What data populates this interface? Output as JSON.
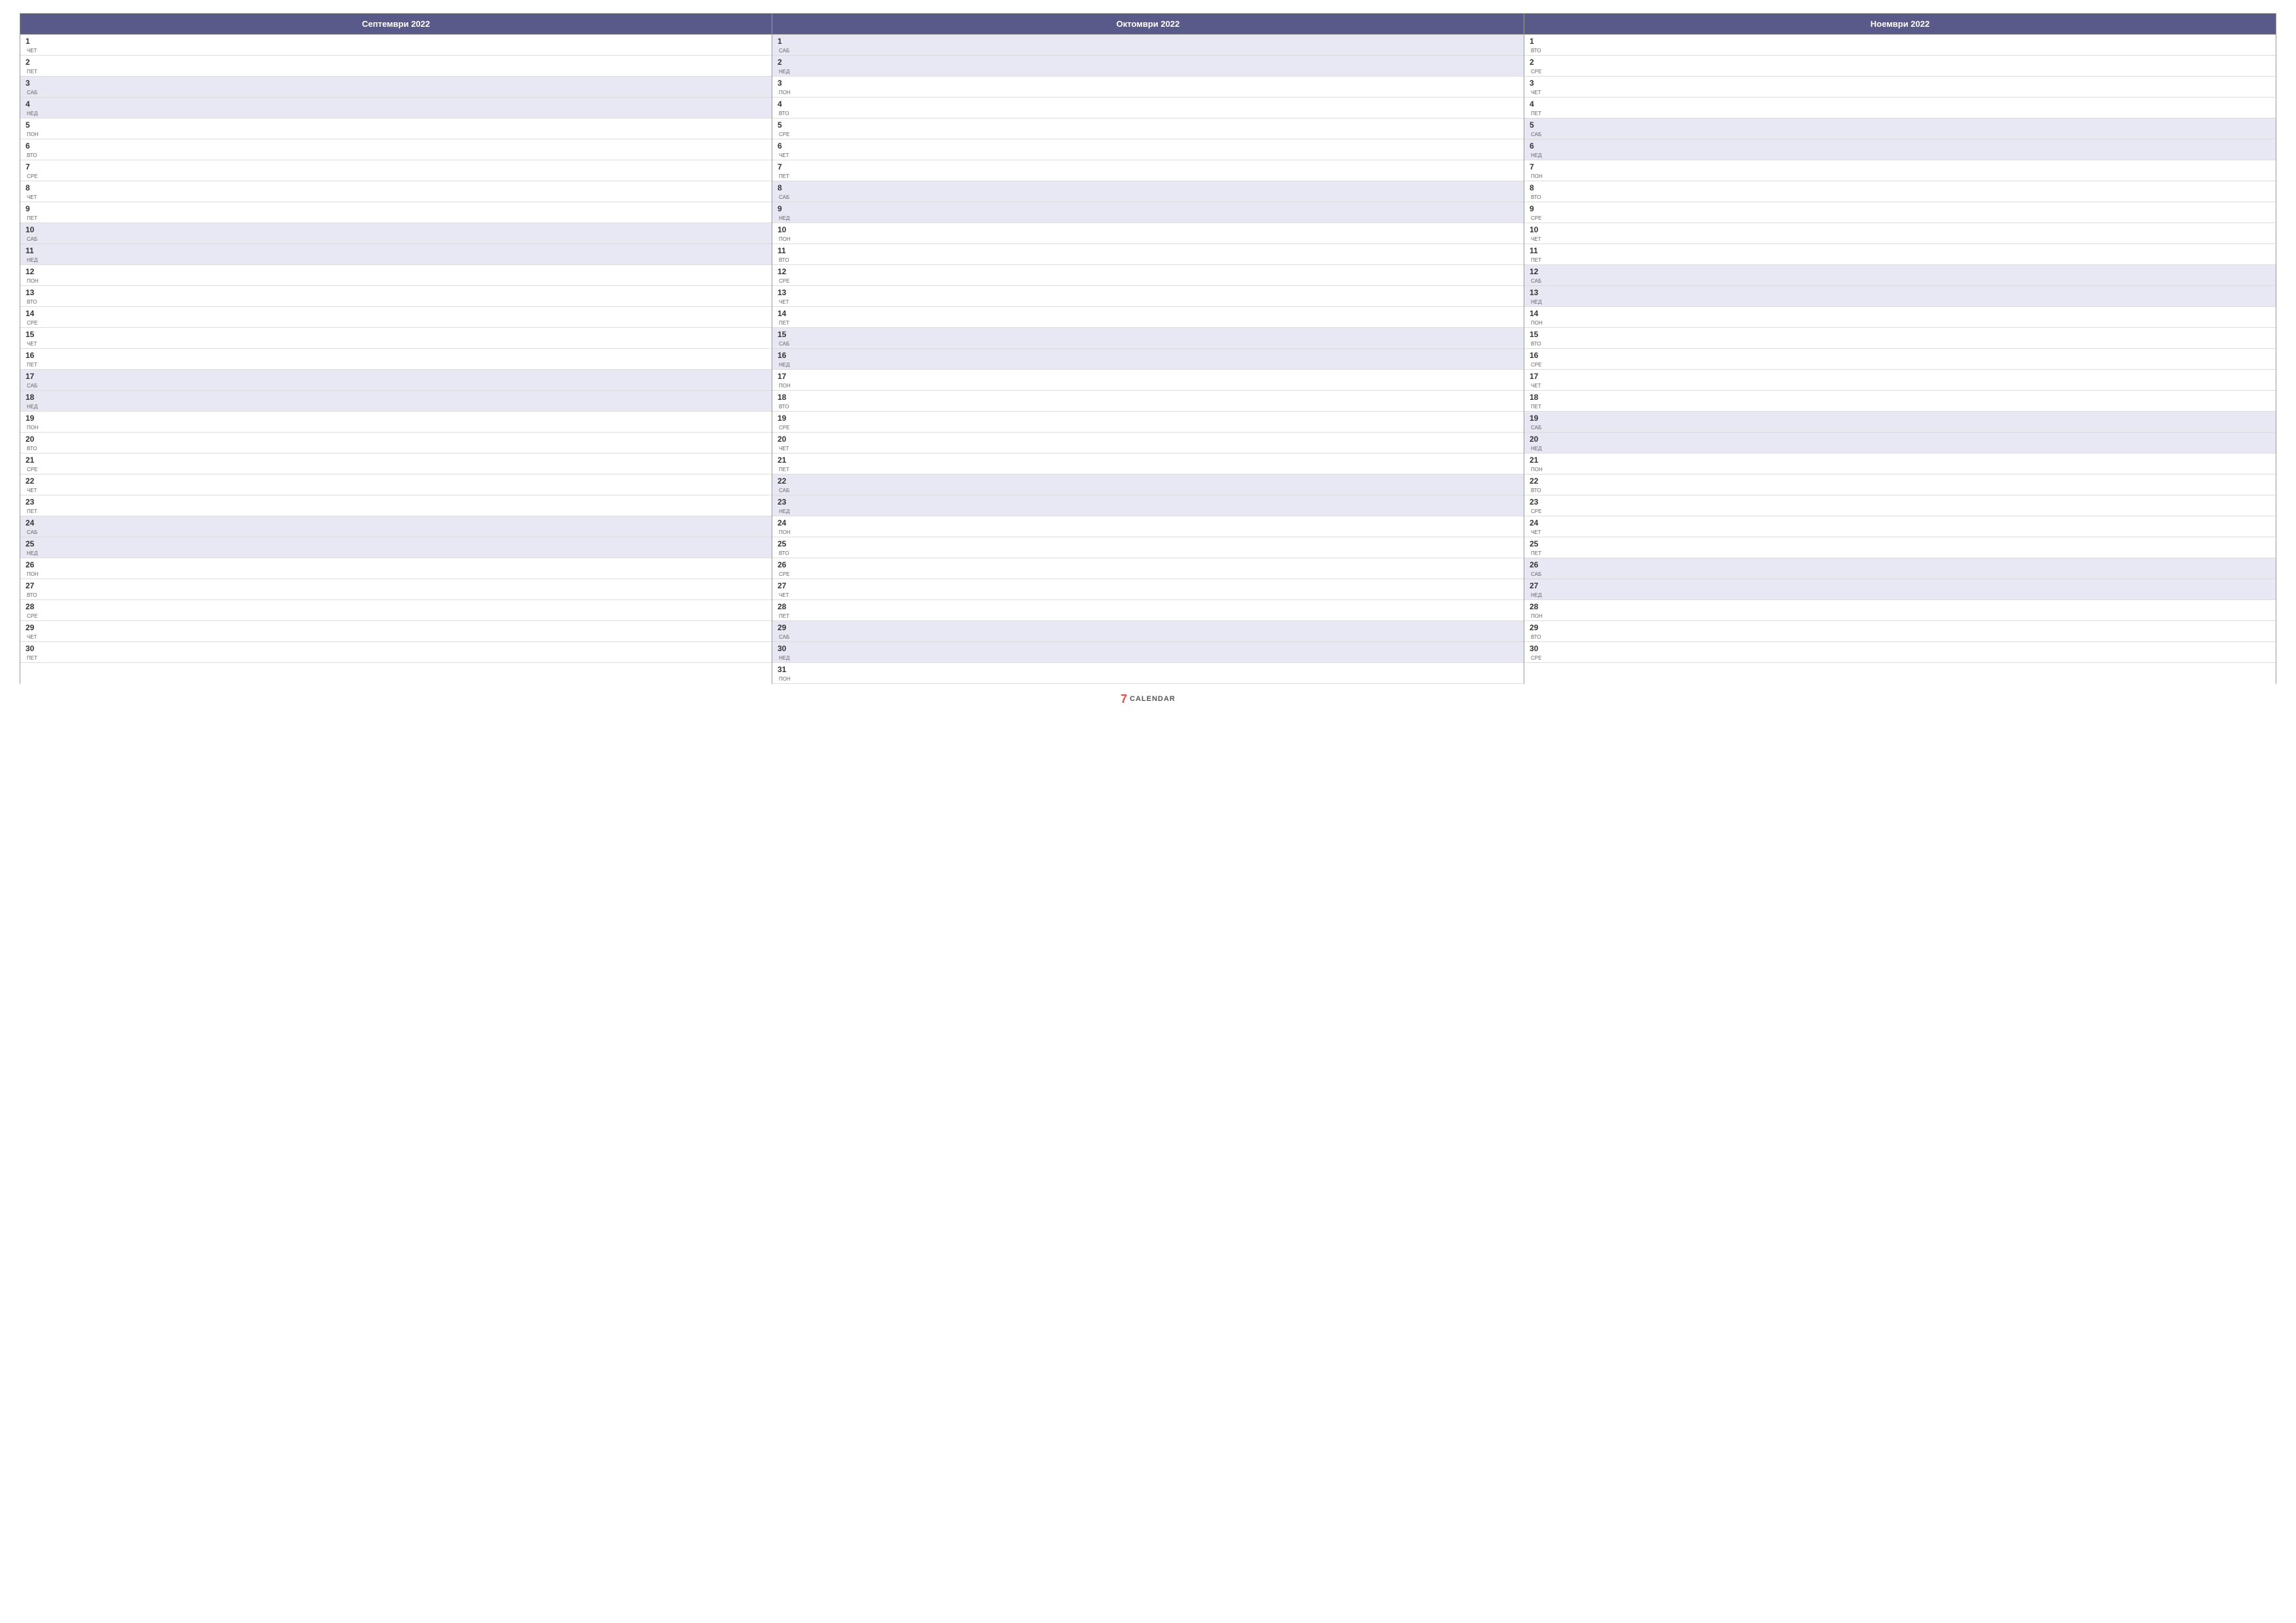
{
  "calendar": {
    "months": [
      {
        "id": "september",
        "header": "Септември 2022",
        "days": [
          {
            "num": "1",
            "name": "ЧЕТ",
            "weekend": false
          },
          {
            "num": "2",
            "name": "ПЕТ",
            "weekend": false
          },
          {
            "num": "3",
            "name": "САБ",
            "weekend": true
          },
          {
            "num": "4",
            "name": "НЕД",
            "weekend": true
          },
          {
            "num": "5",
            "name": "ПОН",
            "weekend": false
          },
          {
            "num": "6",
            "name": "ВТО",
            "weekend": false
          },
          {
            "num": "7",
            "name": "СРЕ",
            "weekend": false
          },
          {
            "num": "8",
            "name": "ЧЕТ",
            "weekend": false
          },
          {
            "num": "9",
            "name": "ПЕТ",
            "weekend": false
          },
          {
            "num": "10",
            "name": "САБ",
            "weekend": true
          },
          {
            "num": "11",
            "name": "НЕД",
            "weekend": true
          },
          {
            "num": "12",
            "name": "ПОН",
            "weekend": false
          },
          {
            "num": "13",
            "name": "ВТО",
            "weekend": false
          },
          {
            "num": "14",
            "name": "СРЕ",
            "weekend": false
          },
          {
            "num": "15",
            "name": "ЧЕТ",
            "weekend": false
          },
          {
            "num": "16",
            "name": "ПЕТ",
            "weekend": false
          },
          {
            "num": "17",
            "name": "САБ",
            "weekend": true
          },
          {
            "num": "18",
            "name": "НЕД",
            "weekend": true
          },
          {
            "num": "19",
            "name": "ПОН",
            "weekend": false
          },
          {
            "num": "20",
            "name": "ВТО",
            "weekend": false
          },
          {
            "num": "21",
            "name": "СРЕ",
            "weekend": false
          },
          {
            "num": "22",
            "name": "ЧЕТ",
            "weekend": false
          },
          {
            "num": "23",
            "name": "ПЕТ",
            "weekend": false
          },
          {
            "num": "24",
            "name": "САБ",
            "weekend": true
          },
          {
            "num": "25",
            "name": "НЕД",
            "weekend": true
          },
          {
            "num": "26",
            "name": "ПОН",
            "weekend": false
          },
          {
            "num": "27",
            "name": "ВТО",
            "weekend": false
          },
          {
            "num": "28",
            "name": "СРЕ",
            "weekend": false
          },
          {
            "num": "29",
            "name": "ЧЕТ",
            "weekend": false
          },
          {
            "num": "30",
            "name": "ПЕТ",
            "weekend": false
          }
        ]
      },
      {
        "id": "october",
        "header": "Октомври 2022",
        "days": [
          {
            "num": "1",
            "name": "САБ",
            "weekend": true
          },
          {
            "num": "2",
            "name": "НЕД",
            "weekend": true
          },
          {
            "num": "3",
            "name": "ПОН",
            "weekend": false
          },
          {
            "num": "4",
            "name": "ВТО",
            "weekend": false
          },
          {
            "num": "5",
            "name": "СРЕ",
            "weekend": false
          },
          {
            "num": "6",
            "name": "ЧЕТ",
            "weekend": false
          },
          {
            "num": "7",
            "name": "ПЕТ",
            "weekend": false
          },
          {
            "num": "8",
            "name": "САБ",
            "weekend": true
          },
          {
            "num": "9",
            "name": "НЕД",
            "weekend": true
          },
          {
            "num": "10",
            "name": "ПОН",
            "weekend": false
          },
          {
            "num": "11",
            "name": "ВТО",
            "weekend": false
          },
          {
            "num": "12",
            "name": "СРЕ",
            "weekend": false
          },
          {
            "num": "13",
            "name": "ЧЕТ",
            "weekend": false
          },
          {
            "num": "14",
            "name": "ПЕТ",
            "weekend": false
          },
          {
            "num": "15",
            "name": "САБ",
            "weekend": true
          },
          {
            "num": "16",
            "name": "НЕД",
            "weekend": true
          },
          {
            "num": "17",
            "name": "ПОН",
            "weekend": false
          },
          {
            "num": "18",
            "name": "ВТО",
            "weekend": false
          },
          {
            "num": "19",
            "name": "СРЕ",
            "weekend": false
          },
          {
            "num": "20",
            "name": "ЧЕТ",
            "weekend": false
          },
          {
            "num": "21",
            "name": "ПЕТ",
            "weekend": false
          },
          {
            "num": "22",
            "name": "САБ",
            "weekend": true
          },
          {
            "num": "23",
            "name": "НЕД",
            "weekend": true
          },
          {
            "num": "24",
            "name": "ПОН",
            "weekend": false
          },
          {
            "num": "25",
            "name": "ВТО",
            "weekend": false
          },
          {
            "num": "26",
            "name": "СРЕ",
            "weekend": false
          },
          {
            "num": "27",
            "name": "ЧЕТ",
            "weekend": false
          },
          {
            "num": "28",
            "name": "ПЕТ",
            "weekend": false
          },
          {
            "num": "29",
            "name": "САБ",
            "weekend": true
          },
          {
            "num": "30",
            "name": "НЕД",
            "weekend": true
          },
          {
            "num": "31",
            "name": "ПОН",
            "weekend": false
          }
        ]
      },
      {
        "id": "november",
        "header": "Ноември 2022",
        "days": [
          {
            "num": "1",
            "name": "ВТО",
            "weekend": false
          },
          {
            "num": "2",
            "name": "СРЕ",
            "weekend": false
          },
          {
            "num": "3",
            "name": "ЧЕТ",
            "weekend": false
          },
          {
            "num": "4",
            "name": "ПЕТ",
            "weekend": false
          },
          {
            "num": "5",
            "name": "САБ",
            "weekend": true
          },
          {
            "num": "6",
            "name": "НЕД",
            "weekend": true
          },
          {
            "num": "7",
            "name": "ПОН",
            "weekend": false
          },
          {
            "num": "8",
            "name": "ВТО",
            "weekend": false
          },
          {
            "num": "9",
            "name": "СРЕ",
            "weekend": false
          },
          {
            "num": "10",
            "name": "ЧЕТ",
            "weekend": false
          },
          {
            "num": "11",
            "name": "ПЕТ",
            "weekend": false
          },
          {
            "num": "12",
            "name": "САБ",
            "weekend": true
          },
          {
            "num": "13",
            "name": "НЕД",
            "weekend": true
          },
          {
            "num": "14",
            "name": "ПОН",
            "weekend": false
          },
          {
            "num": "15",
            "name": "ВТО",
            "weekend": false
          },
          {
            "num": "16",
            "name": "СРЕ",
            "weekend": false
          },
          {
            "num": "17",
            "name": "ЧЕТ",
            "weekend": false
          },
          {
            "num": "18",
            "name": "ПЕТ",
            "weekend": false
          },
          {
            "num": "19",
            "name": "САБ",
            "weekend": true
          },
          {
            "num": "20",
            "name": "НЕД",
            "weekend": true
          },
          {
            "num": "21",
            "name": "ПОН",
            "weekend": false
          },
          {
            "num": "22",
            "name": "ВТО",
            "weekend": false
          },
          {
            "num": "23",
            "name": "СРЕ",
            "weekend": false
          },
          {
            "num": "24",
            "name": "ЧЕТ",
            "weekend": false
          },
          {
            "num": "25",
            "name": "ПЕТ",
            "weekend": false
          },
          {
            "num": "26",
            "name": "САБ",
            "weekend": true
          },
          {
            "num": "27",
            "name": "НЕД",
            "weekend": true
          },
          {
            "num": "28",
            "name": "ПОН",
            "weekend": false
          },
          {
            "num": "29",
            "name": "ВТО",
            "weekend": false
          },
          {
            "num": "30",
            "name": "СРЕ",
            "weekend": false
          }
        ]
      }
    ],
    "footer": {
      "logo_number": "7",
      "logo_text": "CALENDAR"
    }
  }
}
